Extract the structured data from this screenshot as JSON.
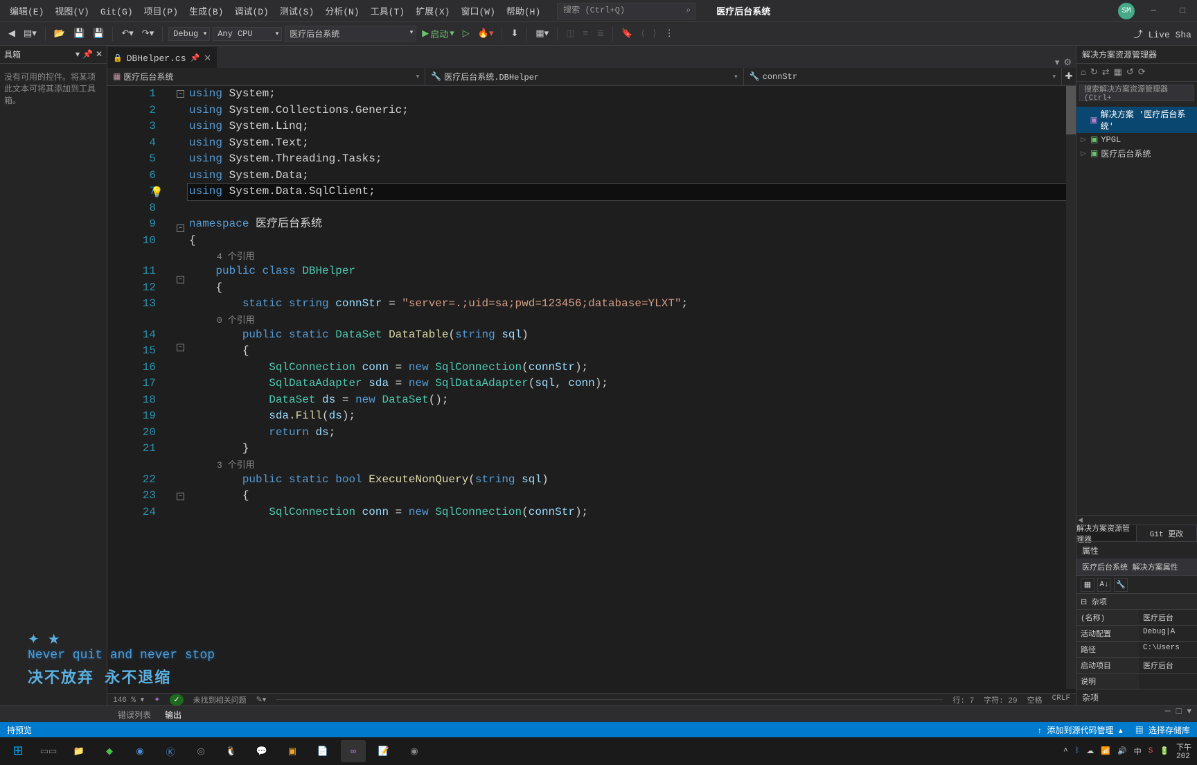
{
  "menus": [
    "编辑(E)",
    "视图(V)",
    "Git(G)",
    "项目(P)",
    "生成(B)",
    "调试(D)",
    "测试(S)",
    "分析(N)",
    "工具(T)",
    "扩展(X)",
    "窗口(W)",
    "帮助(H)"
  ],
  "search_placeholder": "搜索 (Ctrl+Q)",
  "app_title": "医疗后台系统",
  "avatar": "SM",
  "toolbar": {
    "config": "Debug",
    "platform": "Any CPU",
    "project": "医疗后台系统",
    "start": "启动",
    "live": "Live Sha"
  },
  "toolbox": {
    "title": "具箱",
    "msg": "没有可用的控件。将某项此文本可将其添加到工具箱。"
  },
  "tab_file": "DBHelper.cs",
  "nav": {
    "a": "医疗后台系统",
    "b": "医疗后台系统.DBHelper",
    "c": "connStr"
  },
  "code": {
    "lines": [
      {
        "n": 1,
        "t": [
          [
            "kw",
            "using"
          ],
          [
            "pl",
            " "
          ],
          [
            "pl",
            "System;"
          ]
        ],
        "fold": "-"
      },
      {
        "n": 2,
        "t": [
          [
            "kw",
            "using"
          ],
          [
            "pl",
            " System.Collections.Generic;"
          ]
        ]
      },
      {
        "n": 3,
        "t": [
          [
            "kw",
            "using"
          ],
          [
            "pl",
            " System.Linq;"
          ]
        ]
      },
      {
        "n": 4,
        "t": [
          [
            "kw",
            "using"
          ],
          [
            "pl",
            " System.Text;"
          ]
        ]
      },
      {
        "n": 5,
        "t": [
          [
            "kw",
            "using"
          ],
          [
            "pl",
            " System.Threading.Tasks;"
          ]
        ]
      },
      {
        "n": 6,
        "t": [
          [
            "kw",
            "using"
          ],
          [
            "pl",
            " System.Data;"
          ]
        ]
      },
      {
        "n": 7,
        "t": [
          [
            "kw",
            "using"
          ],
          [
            "pl",
            " System.Data.SqlClient;"
          ]
        ],
        "hl": true,
        "bulb": true
      },
      {
        "n": 8,
        "t": [
          [
            "pl",
            ""
          ]
        ]
      },
      {
        "n": 9,
        "t": [
          [
            "kw",
            "namespace"
          ],
          [
            "pl",
            " 医疗后台系统"
          ]
        ],
        "fold": "-"
      },
      {
        "n": 10,
        "t": [
          [
            "pl",
            "{"
          ]
        ]
      },
      {
        "ref": "4 个引用"
      },
      {
        "n": 11,
        "t": [
          [
            "pl",
            "    "
          ],
          [
            "kw",
            "public"
          ],
          [
            "pl",
            " "
          ],
          [
            "kw",
            "class"
          ],
          [
            "pl",
            " "
          ],
          [
            "cls",
            "DBHelper"
          ]
        ],
        "fold": "-"
      },
      {
        "n": 12,
        "t": [
          [
            "pl",
            "    {"
          ]
        ]
      },
      {
        "n": 13,
        "t": [
          [
            "pl",
            "        "
          ],
          [
            "kw",
            "static"
          ],
          [
            "pl",
            " "
          ],
          [
            "kw",
            "string"
          ],
          [
            "pl",
            " "
          ],
          [
            "var",
            "connStr"
          ],
          [
            "pl",
            " = "
          ],
          [
            "str",
            "\"server=.;uid=sa;pwd=123456;database=YLXT\""
          ],
          [
            "pl",
            ";"
          ]
        ]
      },
      {
        "ref": "0 个引用"
      },
      {
        "n": 14,
        "t": [
          [
            "pl",
            "        "
          ],
          [
            "kw",
            "public"
          ],
          [
            "pl",
            " "
          ],
          [
            "kw",
            "static"
          ],
          [
            "pl",
            " "
          ],
          [
            "cls",
            "DataSet"
          ],
          [
            "pl",
            " "
          ],
          [
            "id",
            "DataTable"
          ],
          [
            "pl",
            "("
          ],
          [
            "kw",
            "string"
          ],
          [
            "pl",
            " "
          ],
          [
            "var",
            "sql"
          ],
          [
            "pl",
            ")"
          ]
        ],
        "fold": "-"
      },
      {
        "n": 15,
        "t": [
          [
            "pl",
            "        {"
          ]
        ]
      },
      {
        "n": 16,
        "t": [
          [
            "pl",
            "            "
          ],
          [
            "cls",
            "SqlConnection"
          ],
          [
            "pl",
            " "
          ],
          [
            "var",
            "conn"
          ],
          [
            "pl",
            " = "
          ],
          [
            "kw",
            "new"
          ],
          [
            "pl",
            " "
          ],
          [
            "cls",
            "SqlConnection"
          ],
          [
            "pl",
            "("
          ],
          [
            "var",
            "connStr"
          ],
          [
            "pl",
            ");"
          ]
        ]
      },
      {
        "n": 17,
        "t": [
          [
            "pl",
            "            "
          ],
          [
            "cls",
            "SqlDataAdapter"
          ],
          [
            "pl",
            " "
          ],
          [
            "var",
            "sda"
          ],
          [
            "pl",
            " = "
          ],
          [
            "kw",
            "new"
          ],
          [
            "pl",
            " "
          ],
          [
            "cls",
            "SqlDataAdapter"
          ],
          [
            "pl",
            "("
          ],
          [
            "var",
            "sql"
          ],
          [
            "pl",
            ", "
          ],
          [
            "var",
            "conn"
          ],
          [
            "pl",
            ");"
          ]
        ]
      },
      {
        "n": 18,
        "t": [
          [
            "pl",
            "            "
          ],
          [
            "cls",
            "DataSet"
          ],
          [
            "pl",
            " "
          ],
          [
            "var",
            "ds"
          ],
          [
            "pl",
            " = "
          ],
          [
            "kw",
            "new"
          ],
          [
            "pl",
            " "
          ],
          [
            "cls",
            "DataSet"
          ],
          [
            "pl",
            "();"
          ]
        ]
      },
      {
        "n": 19,
        "t": [
          [
            "pl",
            "            "
          ],
          [
            "var",
            "sda"
          ],
          [
            "pl",
            "."
          ],
          [
            "id",
            "Fill"
          ],
          [
            "pl",
            "("
          ],
          [
            "var",
            "ds"
          ],
          [
            "pl",
            ");"
          ]
        ]
      },
      {
        "n": 20,
        "t": [
          [
            "pl",
            "            "
          ],
          [
            "kw",
            "return"
          ],
          [
            "pl",
            " "
          ],
          [
            "var",
            "ds"
          ],
          [
            "pl",
            ";"
          ]
        ]
      },
      {
        "n": 21,
        "t": [
          [
            "pl",
            "        }"
          ]
        ]
      },
      {
        "ref": "3 个引用"
      },
      {
        "n": 22,
        "t": [
          [
            "pl",
            "        "
          ],
          [
            "kw",
            "public"
          ],
          [
            "pl",
            " "
          ],
          [
            "kw",
            "static"
          ],
          [
            "pl",
            " "
          ],
          [
            "kw",
            "bool"
          ],
          [
            "pl",
            " "
          ],
          [
            "id",
            "ExecuteNonQuery"
          ],
          [
            "pl",
            "("
          ],
          [
            "kw",
            "string"
          ],
          [
            "pl",
            " "
          ],
          [
            "var",
            "sql"
          ],
          [
            "pl",
            ")"
          ]
        ],
        "fold": "-"
      },
      {
        "n": 23,
        "t": [
          [
            "pl",
            "        {"
          ]
        ]
      },
      {
        "n": 24,
        "t": [
          [
            "pl",
            "            "
          ],
          [
            "cls",
            "SqlConnection"
          ],
          [
            "pl",
            " "
          ],
          [
            "var",
            "conn"
          ],
          [
            "pl",
            " = "
          ],
          [
            "kw",
            "new"
          ],
          [
            "pl",
            " "
          ],
          [
            "cls",
            "SqlConnection"
          ],
          [
            "pl",
            "("
          ],
          [
            "var",
            "connStr"
          ],
          [
            "pl",
            ");"
          ]
        ]
      }
    ]
  },
  "editor_status": {
    "zoom": "146 %",
    "issues": "未找到相关问题",
    "ln": "行: 7",
    "col": "字符: 29",
    "ins": "空格",
    "eol": "CRLF"
  },
  "solution": {
    "title": "解决方案资源管理器",
    "search": "搜索解决方案资源管理器(Ctrl+",
    "root": "解决方案 '医疗后台系统'",
    "items": [
      "YPGL",
      "医疗后台系统"
    ],
    "tabs": [
      "解决方案资源管理器",
      "Git 更改"
    ]
  },
  "props": {
    "title": "属性",
    "header": "医疗后台系统  解决方案属性",
    "group": "杂项",
    "rows": [
      [
        "(名称)",
        "医疗后台"
      ],
      [
        "活动配置",
        "Debug|A"
      ],
      [
        "路径",
        "C:\\Users"
      ],
      [
        "启动项目",
        "医疗后台"
      ],
      [
        "说明",
        ""
      ]
    ],
    "footer": "杂项"
  },
  "bottom": {
    "tabs": [
      "错误列表",
      "输出"
    ]
  },
  "status": {
    "preview": "持预览",
    "add": "添加到源代码管理",
    "select": "选择存储库"
  },
  "overlay": {
    "l1": "Never  quit and never stop",
    "l2": "决不放弃 永不退缩"
  },
  "tray": {
    "zh": "中",
    "time": "下午",
    "date": "202"
  }
}
